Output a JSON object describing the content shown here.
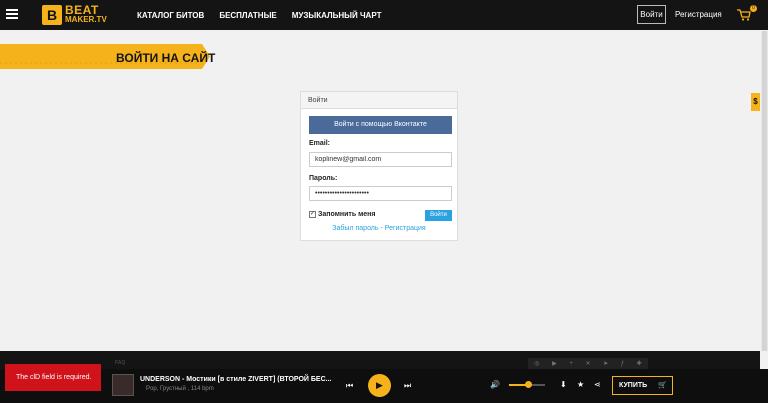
{
  "header": {
    "logo_top": "BEAT",
    "logo_bottom": "MAKER.TV",
    "nav": [
      "КАТАЛОГ БИТОВ",
      "БЕСПЛАТНЫЕ",
      "МУЗЫКАЛЬНЫЙ ЧАРТ"
    ],
    "login_label": "Войти",
    "register_label": "Регистрация",
    "cart_count": "0"
  },
  "page": {
    "title": "ВОЙТИ НА САЙТ",
    "side_badge": "$"
  },
  "login_form": {
    "header": "Войти",
    "vk_button": "Войти с помощью Вконтакте",
    "email_label": "Email:",
    "email_value": "koplinew@gmail.com",
    "password_label": "Пароль:",
    "password_value": "••••••••••••••••••••••",
    "remember_label": "Запомнить меня",
    "remember_checked": true,
    "submit_label": "Войти",
    "forgot_link": "Забыл пароль",
    "separator": " - ",
    "register_link": "Регистрация"
  },
  "footer": {
    "nav": [
      "FAQ"
    ]
  },
  "toast": {
    "message": "The clD field is required."
  },
  "player": {
    "track_title": "UNDERSON - Мостики [в стиле ZIVERT] (ВТОРОЙ БЕС...",
    "track_meta": "Pop, Грустный , 114 bpm",
    "buy_label": "КУПИТЬ"
  },
  "colors": {
    "accent": "#f5b21b",
    "dark": "#141414",
    "vk": "#4a6a9a",
    "link": "#2aa2e0",
    "error": "#d0121b"
  }
}
